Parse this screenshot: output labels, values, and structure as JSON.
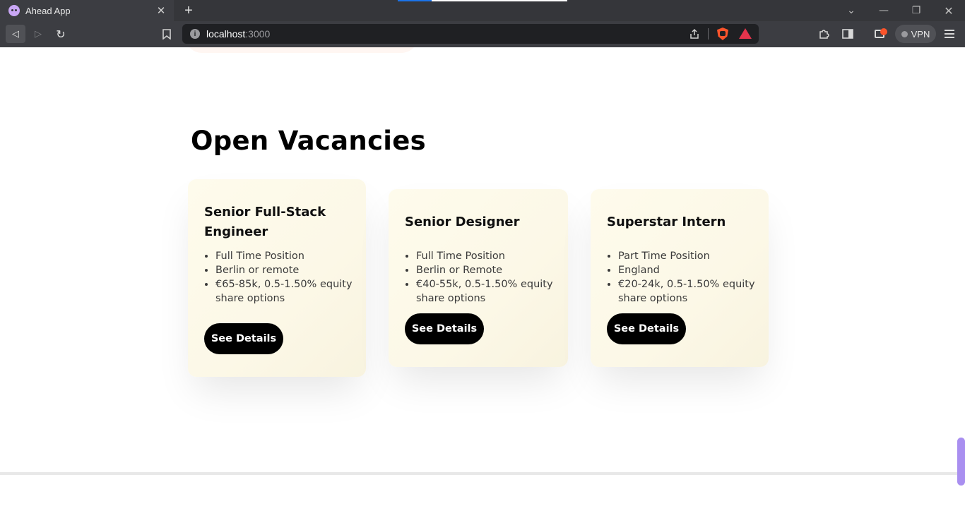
{
  "browser": {
    "tab": {
      "title": "Ahead App",
      "close": "✕"
    },
    "new_tab": "+",
    "window_controls": {
      "tab_list": "⌄",
      "minimize": "—",
      "restore": "❐",
      "close": "✕"
    },
    "nav": {
      "back": "◁",
      "forward": "▷",
      "reload": "↻"
    },
    "address": {
      "host": "localhost",
      "port": ":3000"
    },
    "vpn_label": "VPN"
  },
  "page": {
    "heading": "Open Vacancies",
    "vacancies": [
      {
        "title": "Senior Full-Stack Engineer",
        "details": [
          "Full Time Position",
          "Berlin or remote",
          "€65-85k, 0.5-1.50% equity share options"
        ],
        "button": "See Details"
      },
      {
        "title": "Senior Designer",
        "details": [
          "Full Time Position",
          "Berlin or Remote",
          "€40-55k, 0.5-1.50% equity share options"
        ],
        "button": "See Details"
      },
      {
        "title": "Superstar Intern",
        "details": [
          "Part Time Position",
          "England",
          "€20-24k, 0.5-1.50% equity share options"
        ],
        "button": "See Details"
      }
    ]
  },
  "colors": {
    "card_bg": "#fdf9ea",
    "button_bg": "#000000",
    "scrollbar": "#a98ff0"
  }
}
